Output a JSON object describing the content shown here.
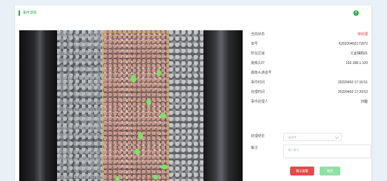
{
  "panel": {
    "title": "事件详情",
    "close_icon": "close-icon",
    "accent_color": "#22a84a"
  },
  "details": {
    "rows": [
      {
        "label": "当前状态",
        "value": "待处理",
        "highlight": true
      },
      {
        "label": "单号",
        "value": "K20220402171972"
      },
      {
        "label": "所在区域",
        "value": "工业相机01"
      },
      {
        "label": "摄像头IP",
        "value": "192.168.1.120"
      },
      {
        "label": "摄像头通道号",
        "value": ""
      },
      {
        "label": "事件时间",
        "value": "20220402 17:16:51"
      },
      {
        "label": "处理时间",
        "value": "20220402 17:20:52"
      },
      {
        "label": "事件处理人",
        "value": "刘楚"
      }
    ]
  },
  "form": {
    "result_label": "处理结论",
    "result_placeholder": "请选择",
    "remark_label": "备注",
    "remark_placeholder": "输入备注"
  },
  "actions": {
    "danger_label": "确认报警",
    "ok_label": "确定"
  },
  "colors": {
    "status_red": "#e23a3a",
    "danger": "#e44a4a",
    "ok": "#8fe0a6"
  }
}
